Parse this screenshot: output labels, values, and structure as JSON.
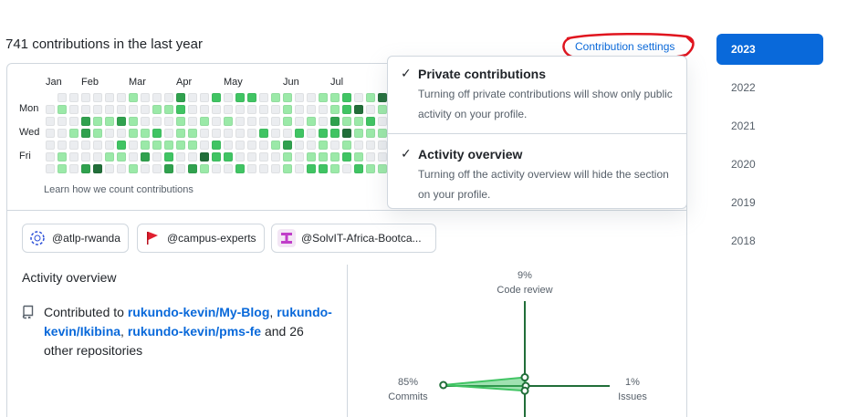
{
  "header": {
    "contributions_title": "741 contributions in the last year",
    "settings_link": "Contribution settings"
  },
  "calendar": {
    "months": [
      "Jan",
      "Feb",
      "Mar",
      "Apr",
      "May",
      "Jun",
      "Jul"
    ],
    "days": [
      "Mon",
      "Wed",
      "Fri"
    ],
    "learn_link": "Learn how we count contributions",
    "colors": {
      "l0": "#ebedf0",
      "l1": "#9be9a8",
      "l2": "#40c463",
      "l3": "#30a14e",
      "l4": "#216e39"
    }
  },
  "orgs": [
    {
      "name": "@atlp-rwanda",
      "icon": "atlp-logo-icon"
    },
    {
      "name": "@campus-experts",
      "icon": "red-flag-icon"
    },
    {
      "name": "@SolvIT-Africa-Bootca...",
      "icon": "solvit-logo-icon"
    }
  ],
  "activity": {
    "title": "Activity overview",
    "contributed_prefix": "Contributed to",
    "repos": [
      "rukundo-kevin/My-Blog",
      "rukundo-kevin/Ikibina",
      "rukundo-kevin/pms-fe"
    ],
    "others": "and 26 other repositories",
    "radar": {
      "code_review_pct": "9%",
      "code_review_label": "Code review",
      "commits_pct": "85%",
      "commits_label": "Commits",
      "issues_pct": "1%",
      "issues_label": "Issues",
      "values": {
        "code_review": 9,
        "commits": 85,
        "issues": 1,
        "pull_requests": 5
      }
    }
  },
  "dropdown": {
    "items": [
      {
        "check": "✓",
        "title": "Private contributions",
        "desc": "Turning off private contributions will show only public activity on your profile."
      },
      {
        "check": "✓",
        "title": "Activity overview",
        "desc": "Turning off the activity overview will hide the section on your profile."
      }
    ]
  },
  "years": [
    "2023",
    "2022",
    "2021",
    "2020",
    "2019",
    "2018"
  ],
  "selected_year": "2023"
}
